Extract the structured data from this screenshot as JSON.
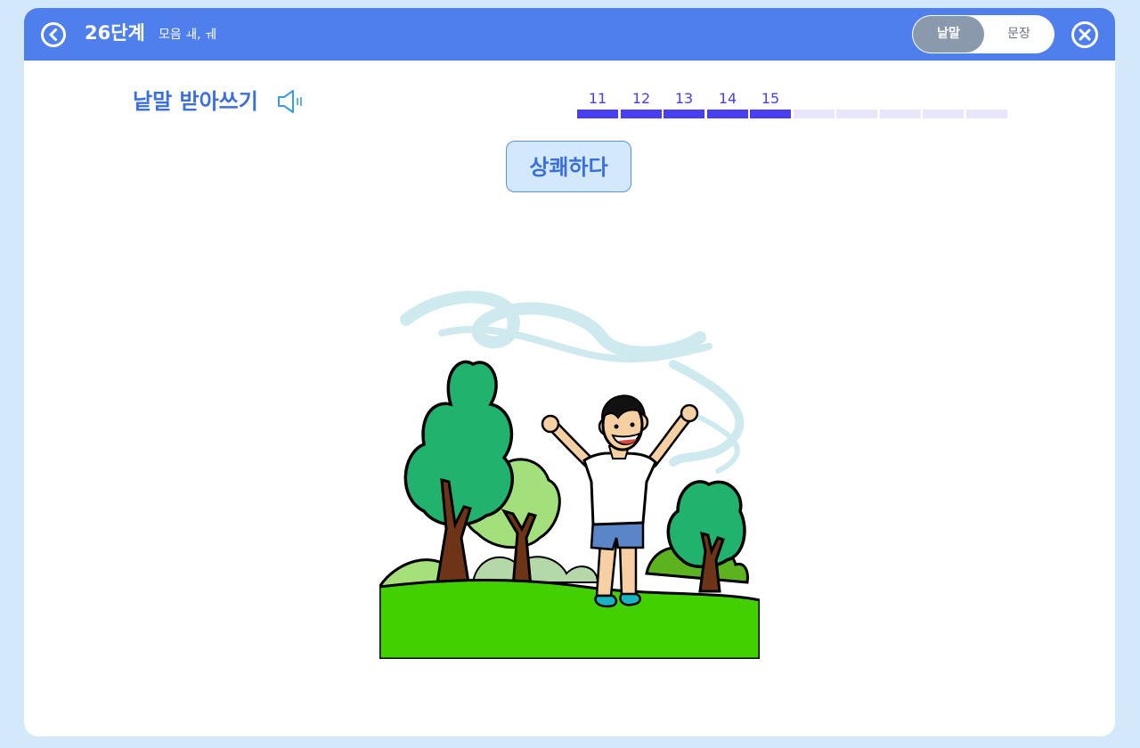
{
  "header": {
    "level_title": "26단계",
    "level_subtitle": "모음 ㅙ, ㅞ",
    "back_icon": "chevron-left-circle-icon",
    "close_icon": "close-circle-icon",
    "mode_toggle": {
      "options": [
        "낱말",
        "문장"
      ],
      "selected": "낱말"
    }
  },
  "exercise": {
    "title": "낱말 받아쓰기",
    "audio_icon": "speaker-icon",
    "progress": {
      "labels": [
        "11",
        "12",
        "13",
        "14",
        "15"
      ],
      "completed": 5,
      "total": 10
    },
    "word": "상쾌하다"
  },
  "colors": {
    "accent": "#4f7fec",
    "progress_done": "#4a3ff0",
    "progress_todo": "#e8e6fb",
    "word_box_bg": "#d3e9fb",
    "page_bg": "#d3e9fb"
  }
}
